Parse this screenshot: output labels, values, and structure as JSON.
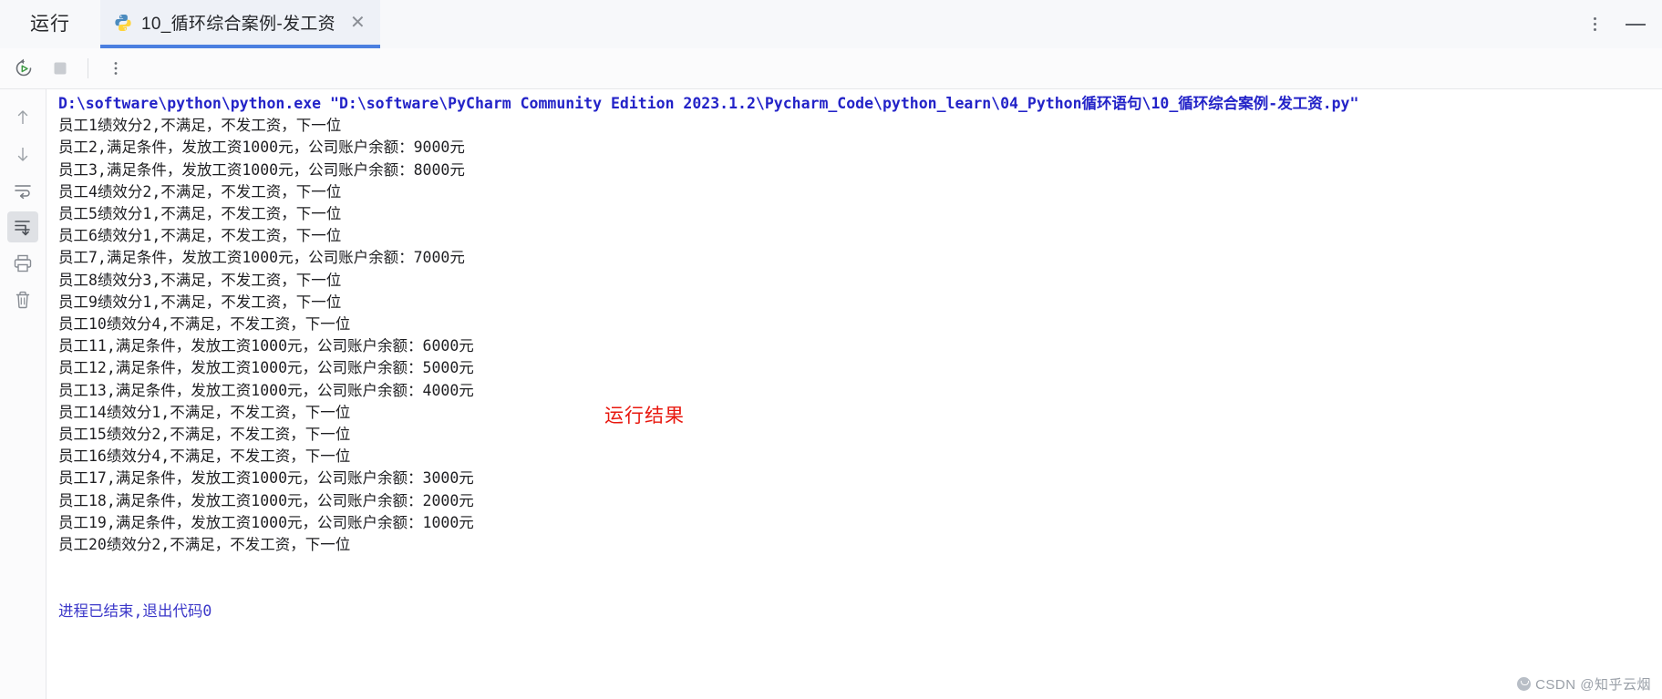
{
  "window": {
    "run_label": "运行",
    "tab_title": "10_循环综合案例-发工资",
    "tab_icon": "python-file-icon",
    "close_label": "✕"
  },
  "run_toolbar": {
    "rerun_tooltip": "Rerun",
    "stop_tooltip": "Stop",
    "more_tooltip": "More"
  },
  "gutter": {
    "up_tooltip": "Up",
    "down_tooltip": "Down",
    "soft_wrap_tooltip": "Soft-Wrap",
    "scroll_end_tooltip": "Scroll to the end",
    "print_tooltip": "Print",
    "clear_tooltip": "Clear All"
  },
  "console": {
    "command": "D:\\software\\python\\python.exe \"D:\\software\\PyCharm Community Edition 2023.1.2\\Pycharm_Code\\python_learn\\04_Python循环语句\\10_循环综合案例-发工资.py\"",
    "lines": [
      "员工1绩效分2,不满足，不发工资，下一位",
      "员工2,满足条件，发放工资1000元，公司账户余额：9000元",
      "员工3,满足条件，发放工资1000元，公司账户余额：8000元",
      "员工4绩效分2,不满足，不发工资，下一位",
      "员工5绩效分1,不满足，不发工资，下一位",
      "员工6绩效分1,不满足，不发工资，下一位",
      "员工7,满足条件，发放工资1000元，公司账户余额：7000元",
      "员工8绩效分3,不满足，不发工资，下一位",
      "员工9绩效分1,不满足，不发工资，下一位",
      "员工10绩效分4,不满足，不发工资，下一位",
      "员工11,满足条件，发放工资1000元，公司账户余额：6000元",
      "员工12,满足条件，发放工资1000元，公司账户余额：5000元",
      "员工13,满足条件，发放工资1000元，公司账户余额：4000元",
      "员工14绩效分1,不满足，不发工资，下一位",
      "员工15绩效分2,不满足，不发工资，下一位",
      "员工16绩效分4,不满足，不发工资，下一位",
      "员工17,满足条件，发放工资1000元，公司账户余额：3000元",
      "员工18,满足条件，发放工资1000元，公司账户余额：2000元",
      "员工19,满足条件，发放工资1000元，公司账户余额：1000元",
      "员工20绩效分2,不满足，不发工资，下一位"
    ],
    "exit_message": "进程已结束,退出代码0"
  },
  "annotation": {
    "text": "运行结果",
    "color": "#e8180f"
  },
  "watermark": {
    "text": "CSDN @知乎云烟"
  },
  "colors": {
    "tab_accent": "#4a7fe0",
    "command_text": "#2323c8",
    "exit_text": "#3b37c9",
    "console_text": "#1f1f22"
  }
}
